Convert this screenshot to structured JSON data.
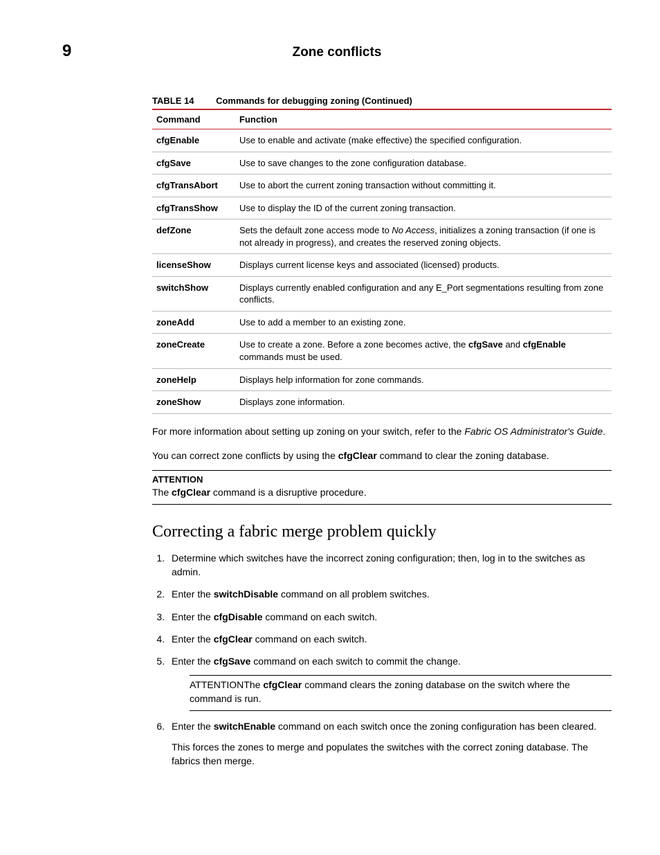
{
  "header": {
    "chapter": "9",
    "title": "Zone conflicts"
  },
  "table": {
    "label": "TABLE 14",
    "title": "Commands for debugging zoning (Continued)",
    "columns": [
      "Command",
      "Function"
    ],
    "rows": [
      {
        "cmd": "cfgEnable",
        "fn_parts": [
          "Use to enable and activate (make effective) the specified configuration."
        ]
      },
      {
        "cmd": "cfgSave",
        "fn_parts": [
          "Use to save changes to the zone configuration database."
        ]
      },
      {
        "cmd": "cfgTransAbort",
        "fn_parts": [
          "Use to abort the current zoning transaction without committing it."
        ]
      },
      {
        "cmd": "cfgTransShow",
        "fn_parts": [
          "Use to display the ID of the current zoning transaction."
        ]
      },
      {
        "cmd": "defZone",
        "fn_parts": [
          "Sets the default zone access mode to ",
          {
            "italic": "No Access"
          },
          ", initializes a zoning transaction (if one is not already in progress), and creates the reserved zoning objects."
        ]
      },
      {
        "cmd": "licenseShow",
        "fn_parts": [
          "Displays current license keys and associated (licensed) products."
        ]
      },
      {
        "cmd": "switchShow",
        "fn_parts": [
          "Displays currently enabled configuration and any E_Port segmentations resulting from zone conflicts."
        ]
      },
      {
        "cmd": "zoneAdd",
        "fn_parts": [
          "Use to add a member to an existing zone."
        ]
      },
      {
        "cmd": "zoneCreate",
        "fn_parts": [
          "Use to create a zone. Before a zone becomes active, the ",
          {
            "bold": "cfgSave"
          },
          " and ",
          {
            "bold": "cfgEnable"
          },
          " commands must be used."
        ]
      },
      {
        "cmd": "zoneHelp",
        "fn_parts": [
          "Displays help information for zone commands."
        ]
      },
      {
        "cmd": "zoneShow",
        "fn_parts": [
          "Displays zone information."
        ]
      }
    ]
  },
  "paragraphs": {
    "p1_parts": [
      "For more information about setting up zoning on your switch, refer to the ",
      {
        "italic": "Fabric OS Administrator's Guide"
      },
      "."
    ],
    "p2_parts": [
      "You can correct zone conflicts by using the ",
      {
        "bold": "cfgClear"
      },
      " command to clear the zoning database."
    ]
  },
  "attention1": {
    "label": "ATTENTION",
    "body_parts": [
      "The ",
      {
        "bold": "cfgClear"
      },
      " command is a disruptive procedure."
    ]
  },
  "section2": {
    "heading": "Correcting a fabric merge problem quickly",
    "steps": [
      {
        "parts": [
          "Determine which switches have the incorrect zoning configuration; then, log in to the switches as admin."
        ]
      },
      {
        "parts": [
          "Enter the ",
          {
            "bold": "switchDisable"
          },
          " command on all problem switches."
        ]
      },
      {
        "parts": [
          "Enter the ",
          {
            "bold": "cfgDisable"
          },
          " command on each switch."
        ]
      },
      {
        "parts": [
          "Enter the ",
          {
            "bold": "cfgClear"
          },
          " command on each switch."
        ]
      },
      {
        "parts": [
          "Enter the ",
          {
            "bold": "cfgSave"
          },
          " command on each switch to commit the change."
        ],
        "attention": {
          "label": "ATTENTION",
          "body_parts": [
            "The ",
            {
              "bold": "cfgClear"
            },
            " command clears the zoning database on the switch where the command is run."
          ]
        }
      },
      {
        "parts": [
          "Enter the ",
          {
            "bold": "switchEnable"
          },
          " command on each switch once the zoning configuration has been cleared."
        ],
        "extra": "This forces the zones to merge and populates the switches with the correct zoning database. The fabrics then merge."
      }
    ]
  }
}
